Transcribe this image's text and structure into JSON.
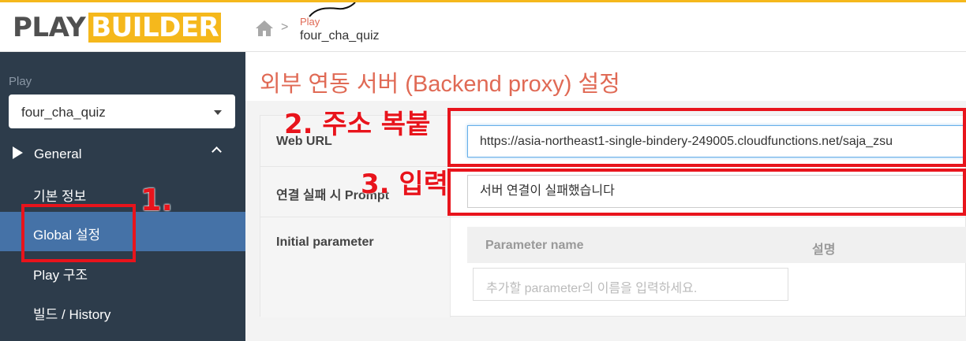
{
  "header": {
    "logo_play": "PLAY",
    "logo_builder": "BUILDER",
    "breadcrumb_parent": "Play",
    "breadcrumb_current": "four_cha_quiz",
    "breadcrumb_separator": ">"
  },
  "sidebar": {
    "section_label": "Play",
    "play_select_value": "four_cha_quiz",
    "group_label": "General",
    "items": [
      {
        "label": "기본 정보",
        "active": false
      },
      {
        "label": "Global 설정",
        "active": true
      },
      {
        "label": "Play 구조",
        "active": false
      },
      {
        "label": "빌드 / History",
        "active": false
      }
    ]
  },
  "main": {
    "title": "외부 연동 서버 (Backend proxy) 설정",
    "fields": {
      "web_url_label": "Web URL",
      "web_url_value": "https://asia-northeast1-single-bindery-249005.cloudfunctions.net/saja_zsu",
      "fail_prompt_label": "연결 실패 시 Prompt",
      "fail_prompt_value": "서버 연결이 실패했습니다",
      "initial_param_label": "Initial parameter"
    },
    "param_table": {
      "col_name": "Parameter name",
      "col_desc": "설명",
      "name_placeholder": "추가할 parameter의 이름을 입력하세요."
    }
  },
  "annotations": {
    "step1": "1.",
    "step2": "2. 주소 복붙",
    "step3": "3. 입력"
  },
  "colors": {
    "accent": "#f5b81c",
    "title": "#e06a55",
    "sidebar_bg": "#2d3c4b",
    "sidebar_active": "#4572a7",
    "annotation": "#e8141c"
  }
}
